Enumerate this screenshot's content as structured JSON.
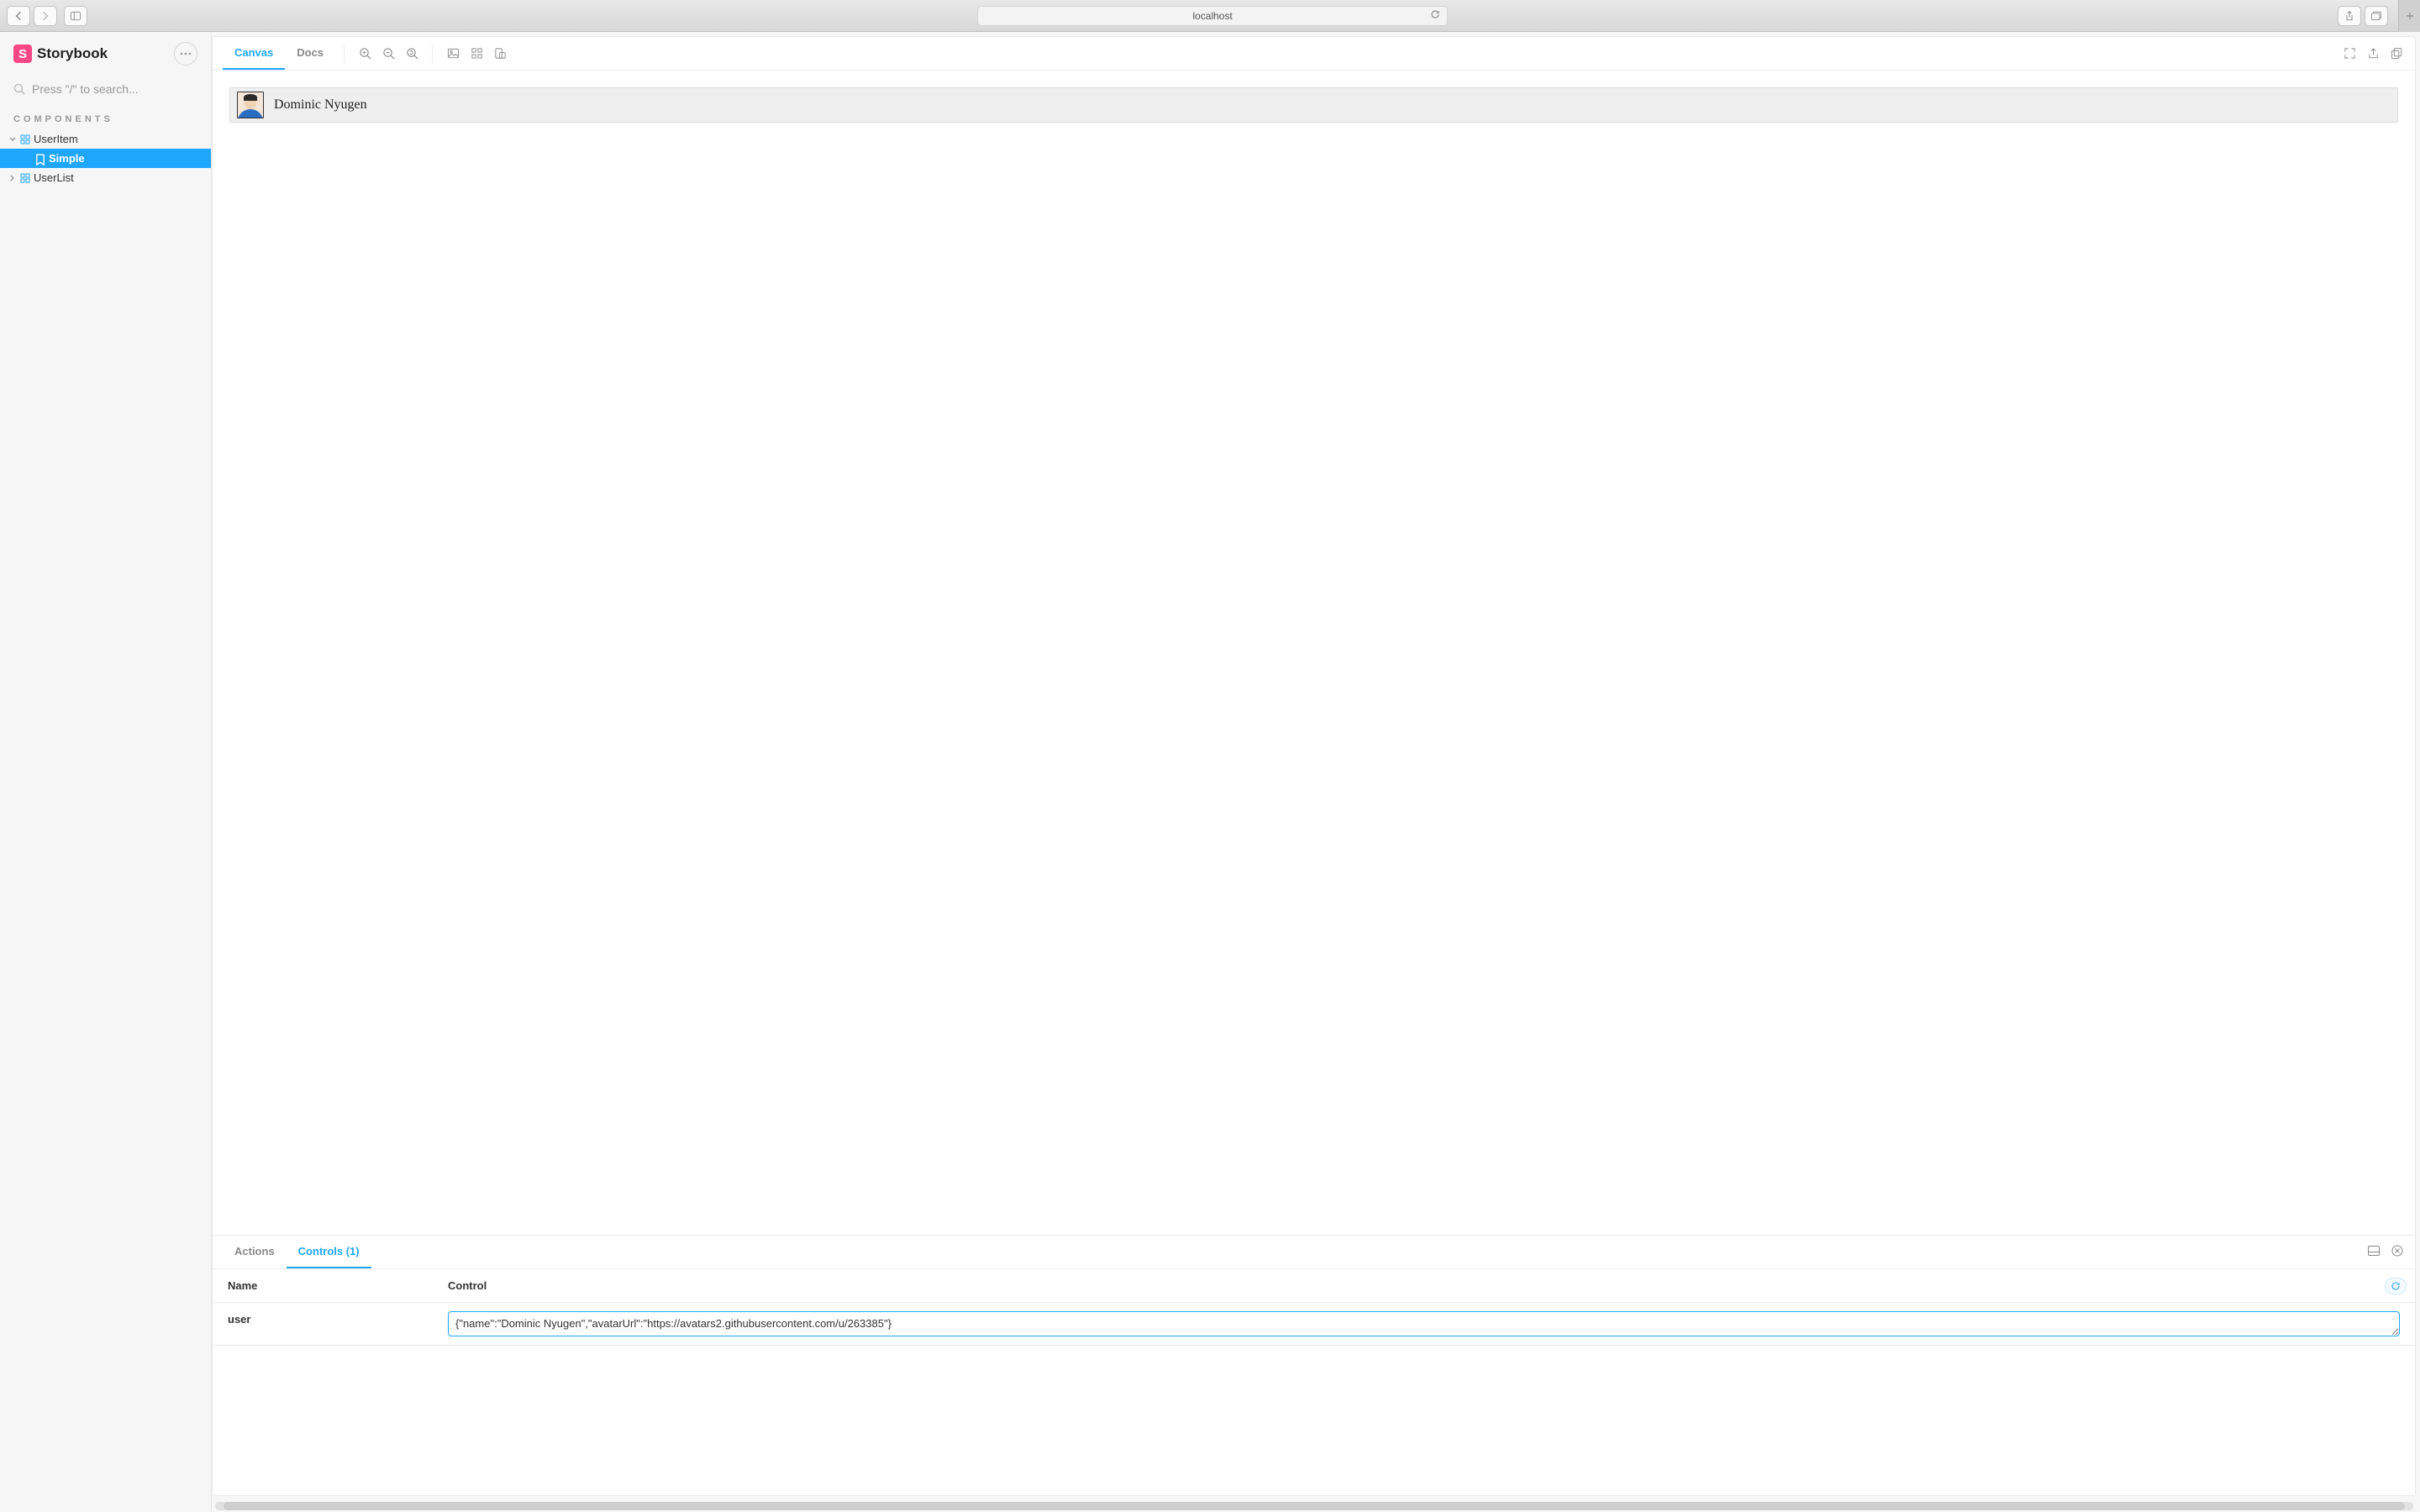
{
  "browser": {
    "url": "localhost"
  },
  "brand": "Storybook",
  "search": {
    "placeholder": "Press \"/\" to search..."
  },
  "sidebar": {
    "section": "COMPONENTS",
    "nodes": {
      "useritem": {
        "label": "UserItem"
      },
      "simple": {
        "label": "Simple"
      },
      "userlist": {
        "label": "UserList"
      }
    }
  },
  "toolbar": {
    "tabs": {
      "canvas": "Canvas",
      "docs": "Docs"
    }
  },
  "preview": {
    "user_name": "Dominic Nyugen"
  },
  "addons": {
    "tabs": {
      "actions": "Actions",
      "controls": "Controls (1)"
    },
    "columns": {
      "name": "Name",
      "control": "Control"
    },
    "rows": {
      "user": {
        "name": "user",
        "value": "{\"name\":\"Dominic Nyugen\",\"avatarUrl\":\"https://avatars2.githubusercontent.com/u/263385\"}"
      }
    }
  }
}
